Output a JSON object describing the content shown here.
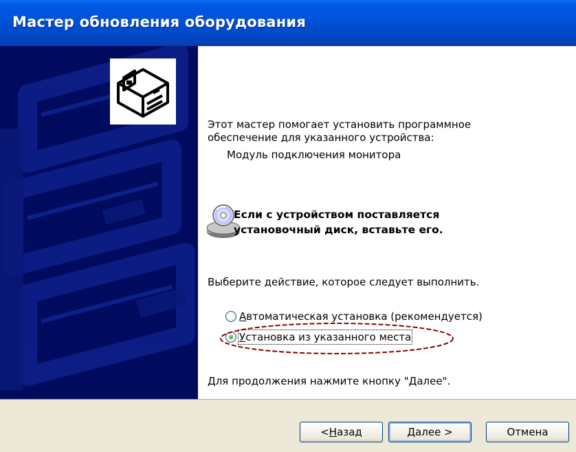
{
  "window": {
    "title": "Мастер обновления оборудования"
  },
  "main": {
    "intro_line1": "Этот мастер помогает установить программное",
    "intro_line2": "обеспечение для указанного устройства:",
    "device_name": "Модуль подключения монитора",
    "note_line1": "Если с устройством поставляется",
    "note_line2": "установочный диск, вставьте его.",
    "choose_action": "Выберите действие, которое следует выполнить.",
    "options": [
      {
        "hotkey": "А",
        "rest": "втоматическая установка (рекомендуется)",
        "selected": false
      },
      {
        "hotkey": "У",
        "rest": "становка из указанного места",
        "selected": true
      }
    ],
    "continue_text": "Для продолжения нажмите кнопку \"Далее\"."
  },
  "buttons": {
    "back_prefix": "< ",
    "back_hotkey": "Н",
    "back_rest": "азад",
    "next_hotkey": "Д",
    "next_rest": "алее >",
    "cancel": "Отмена"
  },
  "colors": {
    "titlebar": "#0052d8",
    "side_panel": "#000b5e",
    "dialog_bg": "#ece9d8",
    "annotation": "#8b0000"
  },
  "icons": {
    "hardware": "hardware-card-icon",
    "disc": "cd-disc-icon"
  }
}
